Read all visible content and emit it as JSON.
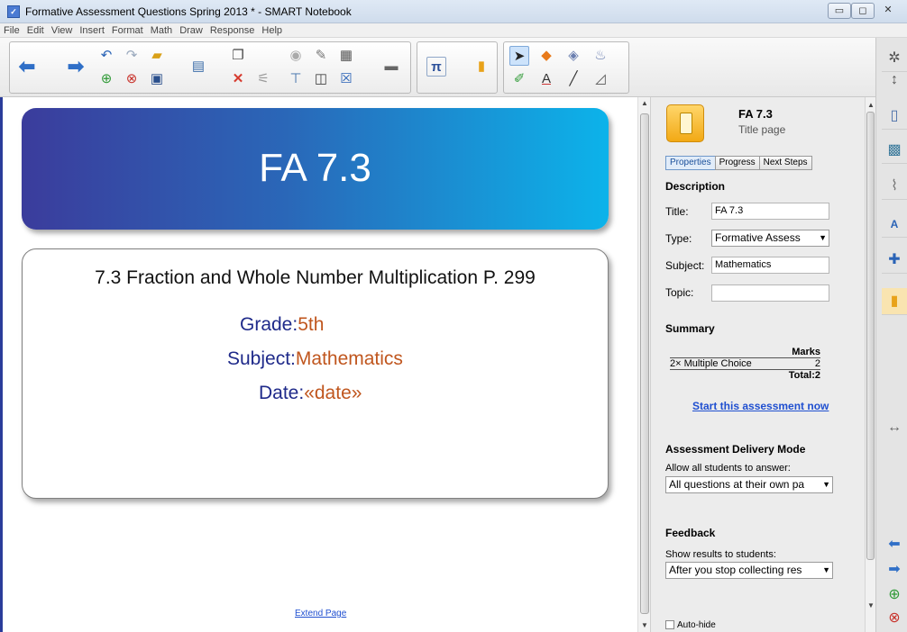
{
  "window": {
    "title": "Formative Assessment Questions Spring 2013 * - SMART Notebook",
    "app_icon": "notebook-icon",
    "controls": [
      "▭",
      "◻",
      "✕"
    ]
  },
  "menu": [
    "File",
    "Edit",
    "View",
    "Insert",
    "Format",
    "Math",
    "Draw",
    "Response",
    "Help"
  ],
  "canvas": {
    "banner_title": "FA 7.3",
    "card_title": "7.3 Fraction and Whole Number Multiplication P. 299",
    "grade_label": "Grade:",
    "grade_value": "5th",
    "subject_label": "Subject:",
    "subject_value": "Mathematics",
    "date_label": "Date:",
    "date_value": "«date»",
    "extend_link": "Extend Page"
  },
  "panel": {
    "heading": "FA 7.3",
    "subheading": "Title page",
    "tabs": [
      "Properties",
      "Progress",
      "Next Steps"
    ],
    "active_tab": "Properties",
    "description_heading": "Description",
    "title_label": "Title:",
    "title_value": "FA 7.3",
    "type_label": "Type:",
    "type_value": "Formative Assess",
    "subject_label": "Subject:",
    "subject_value": "Mathematics",
    "topic_label": "Topic:",
    "topic_value": "",
    "summary_heading": "Summary",
    "marks_header": "Marks",
    "summary_row_label": "2× Multiple Choice",
    "summary_row_value": "2",
    "total_label": "Total:2",
    "start_link": "Start this assessment now",
    "delivery_heading": "Assessment Delivery Mode",
    "delivery_prompt": "Allow all students to answer:",
    "delivery_value": "All questions at their own pa",
    "feedback_heading": "Feedback",
    "feedback_prompt": "Show results to students:",
    "feedback_value": "After you stop collecting res",
    "autohide_label": "Auto-hide"
  },
  "colors": {
    "banner_start": "#3b3c9c",
    "banner_end": "#0cb3ea",
    "label_blue": "#1f2a8a",
    "value_orange": "#c0561e",
    "link_blue": "#1f4fd0"
  }
}
